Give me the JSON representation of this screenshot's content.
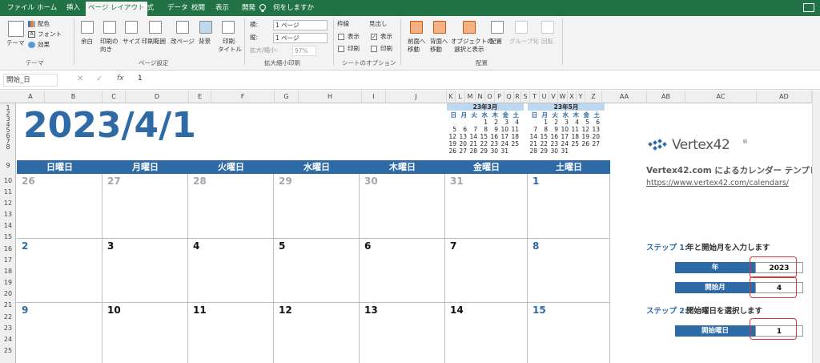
{
  "menu": {
    "tabs": [
      "ファイル",
      "ホーム",
      "挿入",
      "ページ レイアウト",
      "数式",
      "データ",
      "校閲",
      "表示",
      "開発"
    ],
    "active": "ページ レイアウト",
    "tell_me": "何をしますか"
  },
  "ribbon": {
    "theme": {
      "label": "テーマ",
      "colors": "配色",
      "fonts": "フォント",
      "effects": "効果",
      "group": "テーマ"
    },
    "page_setup": {
      "margins": "余白",
      "orientation_1": "印刷の",
      "orientation_2": "向き",
      "size": "サイズ",
      "print_area": "印刷範囲",
      "breaks": "改ページ",
      "background": "背景",
      "print_titles_1": "印刷",
      "print_titles_2": "タイトル",
      "group": "ページ設定"
    },
    "scale": {
      "width_label": "横:",
      "width_value": "1 ページ",
      "height_label": "縦:",
      "height_value": "1 ページ",
      "scale_label": "拡大/縮小:",
      "scale_value": "97%",
      "group": "拡大縮小印刷"
    },
    "sheet_options": {
      "gridlines": "枠線",
      "headings": "見出し",
      "view": "表示",
      "print": "印刷",
      "group": "シートのオプション"
    },
    "arrange": {
      "bring_forward_1": "前面へ",
      "bring_forward_2": "移動",
      "send_backward_1": "背面へ",
      "send_backward_2": "移動",
      "selection_pane_1": "オブジェクトの",
      "selection_pane_2": "選択と表示",
      "align": "配置",
      "group_btn": "グループ化",
      "rotate": "回転",
      "group": "配置"
    }
  },
  "formula_bar": {
    "name_box": "開始_日",
    "fx": "fx",
    "value": "1"
  },
  "columns": [
    "A",
    "B",
    "C",
    "D",
    "E",
    "F",
    "G",
    "H",
    "I",
    "J",
    "K",
    "L",
    "M",
    "N",
    "O",
    "P",
    "Q",
    "R",
    "S",
    "T",
    "U",
    "V",
    "W",
    "X",
    "Y",
    "Z",
    "AA",
    "AB",
    "AC",
    "AD"
  ],
  "rows": [
    "1",
    "2",
    "3",
    "4",
    "5",
    "6",
    "7",
    "8",
    "9",
    "10",
    "11",
    "12",
    "13",
    "14",
    "15",
    "16",
    "17",
    "18",
    "19",
    "20",
    "21",
    "22",
    "23",
    "24",
    "25"
  ],
  "calendar": {
    "title": "2023/4/1",
    "weekdays": [
      "日曜日",
      "月曜日",
      "火曜日",
      "水曜日",
      "木曜日",
      "金曜日",
      "土曜日"
    ],
    "weeks": [
      [
        "26",
        "27",
        "28",
        "29",
        "30",
        "31",
        "1"
      ],
      [
        "2",
        "3",
        "4",
        "5",
        "6",
        "7",
        "8"
      ],
      [
        "9",
        "10",
        "11",
        "12",
        "13",
        "14",
        "15"
      ]
    ],
    "prev_month": {
      "title": "23年3月",
      "heads": [
        "日",
        "月",
        "火",
        "水",
        "木",
        "金",
        "土"
      ],
      "days": [
        [
          "",
          "",
          "",
          "1",
          "2",
          "3",
          "4"
        ],
        [
          "5",
          "6",
          "7",
          "8",
          "9",
          "10",
          "11"
        ],
        [
          "12",
          "13",
          "14",
          "15",
          "16",
          "17",
          "18"
        ],
        [
          "19",
          "20",
          "21",
          "22",
          "23",
          "24",
          "25"
        ],
        [
          "26",
          "27",
          "28",
          "29",
          "30",
          "31",
          ""
        ]
      ]
    },
    "next_month": {
      "title": "23年5月",
      "heads": [
        "日",
        "月",
        "火",
        "水",
        "木",
        "金",
        "土"
      ],
      "days": [
        [
          "",
          "1",
          "2",
          "3",
          "4",
          "5",
          "6"
        ],
        [
          "7",
          "8",
          "9",
          "10",
          "11",
          "12",
          "13"
        ],
        [
          "14",
          "15",
          "16",
          "17",
          "18",
          "19",
          "20"
        ],
        [
          "21",
          "22",
          "23",
          "24",
          "25",
          "26",
          "27"
        ],
        [
          "28",
          "29",
          "30",
          "31",
          "",
          "",
          ""
        ]
      ]
    }
  },
  "side": {
    "logo": "Vertex42",
    "logo_mark": "®",
    "template_title": "Vertex42.com によるカレンダー テンプレート",
    "url": "https://www.vertex42.com/calendars/",
    "step1_num": "ステップ 1:",
    "step1_text": "年と開始月を入力します",
    "year_label": "年",
    "year_value": "2023",
    "month_label": "開始月",
    "month_value": "4",
    "step2_num": "ステップ 2:",
    "step2_text": "開始曜日を選択します",
    "startday_label": "開始曜日",
    "startday_value": "1"
  },
  "colors": {
    "excel_green": "#217346",
    "calendar_blue": "#2e6aa6",
    "highlight_red": "#d9363e"
  }
}
